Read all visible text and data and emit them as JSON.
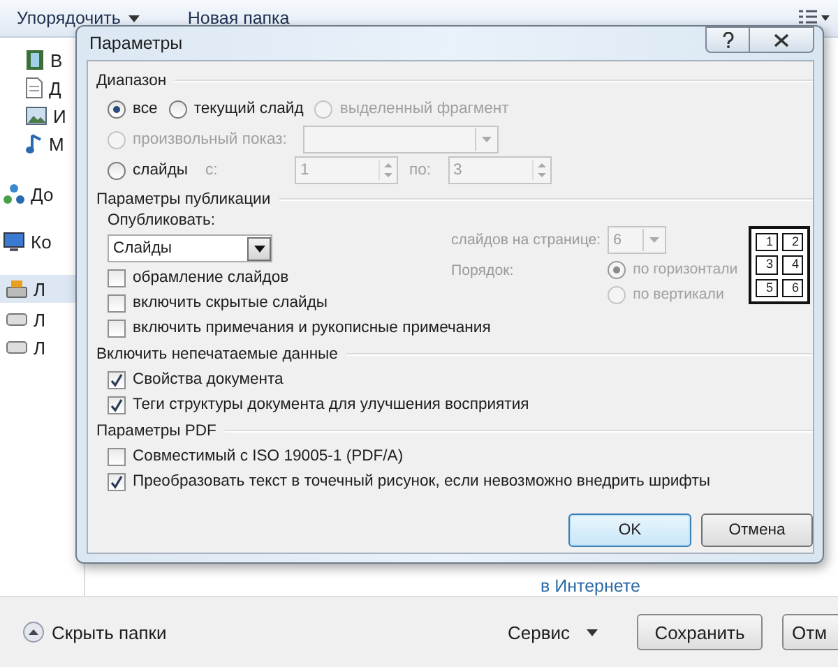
{
  "explorer": {
    "toolbar": [
      {
        "label": "Упорядочить",
        "dropdown": true
      },
      {
        "label": "Новая папка",
        "dropdown": false
      }
    ],
    "sidebar": [
      {
        "children": [
          {
            "label": "В",
            "kind": "video",
            "selected": false
          },
          {
            "label": "Д",
            "kind": "document",
            "selected": false
          },
          {
            "label": "И",
            "kind": "image",
            "selected": false
          },
          {
            "label": "М",
            "kind": "music",
            "selected": false
          }
        ]
      },
      {
        "label": "До",
        "kind": "network",
        "selected": false
      },
      {
        "label": "Ко",
        "kind": "computer",
        "selected": false,
        "children": [
          {
            "label": "Л",
            "kind": "system-drive",
            "selected": true
          },
          {
            "label": "Л",
            "kind": "drive",
            "selected": false
          },
          {
            "label": "Л",
            "kind": "drive",
            "selected": false
          }
        ]
      }
    ],
    "link": "в Интернете",
    "hide_folders": "Скрыть папки",
    "tools": "Сервис",
    "buttons": [
      {
        "label": "Сохранить"
      },
      {
        "label": "Отм"
      }
    ]
  },
  "dialog": {
    "title": "Параметры",
    "range": {
      "heading": "Диапазон",
      "options": [
        {
          "label": "все",
          "selected": true,
          "disabled": false
        },
        {
          "label": "текущий слайд",
          "selected": false,
          "disabled": false
        },
        {
          "label": "выделенный фрагмент",
          "selected": false,
          "disabled": true
        }
      ],
      "custom_show": {
        "label": "произвольный показ:",
        "selected": false,
        "disabled": true
      },
      "slides": {
        "label": "слайды",
        "selected": false,
        "disabled": false,
        "from_label": "с:",
        "from": "1",
        "to_label": "по:",
        "to": "3",
        "fields_disabled": true
      }
    },
    "publish": {
      "heading": "Параметры публикации",
      "what_label": "Опубликовать:",
      "what": "Слайды",
      "options": [
        {
          "label": "обрамление слайдов",
          "checked": false
        },
        {
          "label": "включить скрытые слайды",
          "checked": false
        },
        {
          "label": "включить примечания и рукописные примечания",
          "checked": false
        }
      ],
      "per_page_label": "слайдов на странице:",
      "per_page": "6",
      "order_label": "Порядок:",
      "order": [
        {
          "label": "по горизонтали",
          "selected": true
        },
        {
          "label": "по вертикали",
          "selected": false
        }
      ],
      "handout_disabled": true,
      "preview": [
        "1",
        "2",
        "3",
        "4",
        "5",
        "6"
      ]
    },
    "nonprint": {
      "heading": "Включить непечатаемые данные",
      "options": [
        {
          "label": "Свойства документа",
          "checked": true
        },
        {
          "label": "Теги структуры документа для улучшения восприятия",
          "checked": true
        }
      ]
    },
    "pdf": {
      "heading": "Параметры PDF",
      "options": [
        {
          "label": "Совместимый с ISO 19005-1 (PDF/A)",
          "checked": false
        },
        {
          "label": "Преобразовать текст в точечный рисунок, если невозможно внедрить шрифты",
          "checked": true
        }
      ]
    },
    "buttons": [
      {
        "label": "OK",
        "default": true
      },
      {
        "label": "Отмена",
        "default": false
      }
    ]
  }
}
